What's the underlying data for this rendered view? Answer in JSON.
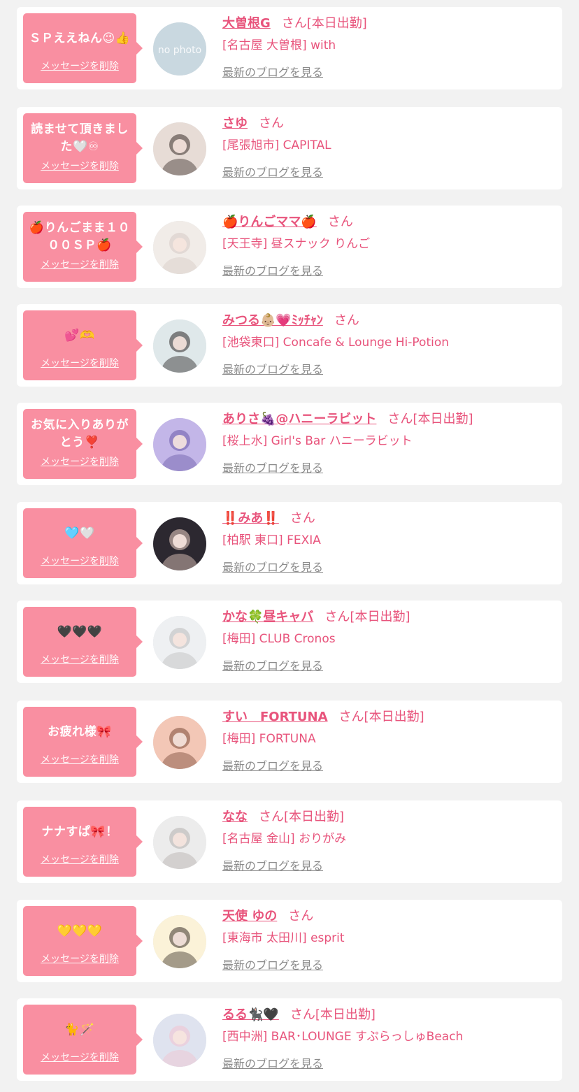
{
  "colors": {
    "accent": "#f98fa1",
    "name": "#e8547c",
    "muted": "#8c8c8c"
  },
  "entries": [
    {
      "message": "ＳＰええねん😉👍",
      "delete_label": "メッセージを削除",
      "name": "大曽根G",
      "honorific": "さん",
      "status": "[本日出勤]",
      "shop": "[名古屋 大曽根] with",
      "blog_label": "最新のブログを見る",
      "avatar_icon": "no-photo-placeholder"
    },
    {
      "message": "読ませて頂きました🤍♾",
      "delete_label": "メッセージを削除",
      "name": "さゆ",
      "honorific": "さん",
      "status": "",
      "shop": "[尾張旭市] CAPITAL",
      "blog_label": "最新のブログを見る",
      "avatar_icon": "profile-photo"
    },
    {
      "message": "🍎りんごまま１０００ＳＰ🍎",
      "delete_label": "メッセージを削除",
      "name": "🍎りんごママ🍎",
      "honorific": "さん",
      "status": "",
      "shop": "[天王寺] 昼スナック りんご",
      "blog_label": "最新のブログを見る",
      "avatar_icon": "profile-photo"
    },
    {
      "message": "💕🫶",
      "delete_label": "メッセージを削除",
      "name": "みつる👶🏼💗ﾐｯﾁｬﾝ",
      "honorific": "さん",
      "status": "",
      "shop": "[池袋東口] Concafe & Lounge Hi-Potion",
      "blog_label": "最新のブログを見る",
      "avatar_icon": "profile-photo"
    },
    {
      "message": "お気に入りありがとう❣️",
      "delete_label": "メッセージを削除",
      "name": "ありさ🍇@ハニーラビット",
      "honorific": "さん",
      "status": "[本日出勤]",
      "shop": "[桜上水] Girl's Bar ハニーラビット",
      "blog_label": "最新のブログを見る",
      "avatar_icon": "profile-photo"
    },
    {
      "message": "🩵🤍",
      "delete_label": "メッセージを削除",
      "name": "‼️みあ‼️",
      "honorific": "さん",
      "status": "",
      "shop": "[柏駅 東口] FEXIA",
      "blog_label": "最新のブログを見る",
      "avatar_icon": "profile-photo"
    },
    {
      "message": "🖤🖤🖤",
      "delete_label": "メッセージを削除",
      "name": "かな🍀昼キャバ",
      "honorific": "さん",
      "status": "[本日出勤]",
      "shop": "[梅田] CLUB Cronos",
      "blog_label": "最新のブログを見る",
      "avatar_icon": "profile-photo"
    },
    {
      "message": "お疲れ様🎀",
      "delete_label": "メッセージを削除",
      "name": "すい　FORTUNA",
      "honorific": "さん",
      "status": "[本日出勤]",
      "shop": "[梅田] FORTUNA",
      "blog_label": "最新のブログを見る",
      "avatar_icon": "profile-photo"
    },
    {
      "message": "ナナすぱ🎀！",
      "delete_label": "メッセージを削除",
      "name": "なな",
      "honorific": "さん",
      "status": "[本日出勤]",
      "shop": "[名古屋 金山] おりがみ",
      "blog_label": "最新のブログを見る",
      "avatar_icon": "profile-photo"
    },
    {
      "message": "💛💛💛",
      "delete_label": "メッセージを削除",
      "name": "天使 ゆの",
      "honorific": "さん",
      "status": "",
      "shop": "[東海市 太田川] esprit",
      "blog_label": "最新のブログを見る",
      "avatar_icon": "profile-photo"
    },
    {
      "message": "🐈🪄",
      "delete_label": "メッセージを削除",
      "name": "るる🐈‍⬛🖤",
      "honorific": "さん",
      "status": "[本日出勤]",
      "shop": "[西中洲] BAR･LOUNGE すぷらっしゅBeach",
      "blog_label": "最新のブログを見る",
      "avatar_icon": "profile-photo"
    }
  ]
}
